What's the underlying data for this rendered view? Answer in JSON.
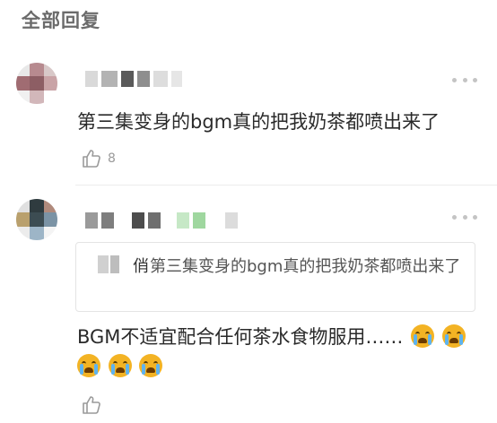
{
  "section": {
    "title": "全部回复"
  },
  "comments": [
    {
      "text": "第三集变身的bgm真的把我奶茶都喷出来了",
      "likes": "8",
      "icons": {
        "avatar": "avatar-blurred",
        "more": "more-dots-icon",
        "like": "thumbs-up-icon"
      }
    },
    {
      "quote": {
        "tail_char": "俏",
        "text": "第三集变身的bgm真的把我奶茶都喷出来了"
      },
      "text": "BGM不适宜配合任何茶水食物服用……",
      "emoji_count": 5,
      "emoji_name": "crying-face-emoji",
      "likes": "",
      "icons": {
        "avatar": "avatar-blurred",
        "more": "more-dots-icon",
        "like": "thumbs-up-icon"
      }
    }
  ],
  "colors": {
    "title": "#6b6b6b",
    "text": "#2a2a2a",
    "muted": "#9a9a9a",
    "divider": "#ececec",
    "emoji": "#f3b324"
  }
}
